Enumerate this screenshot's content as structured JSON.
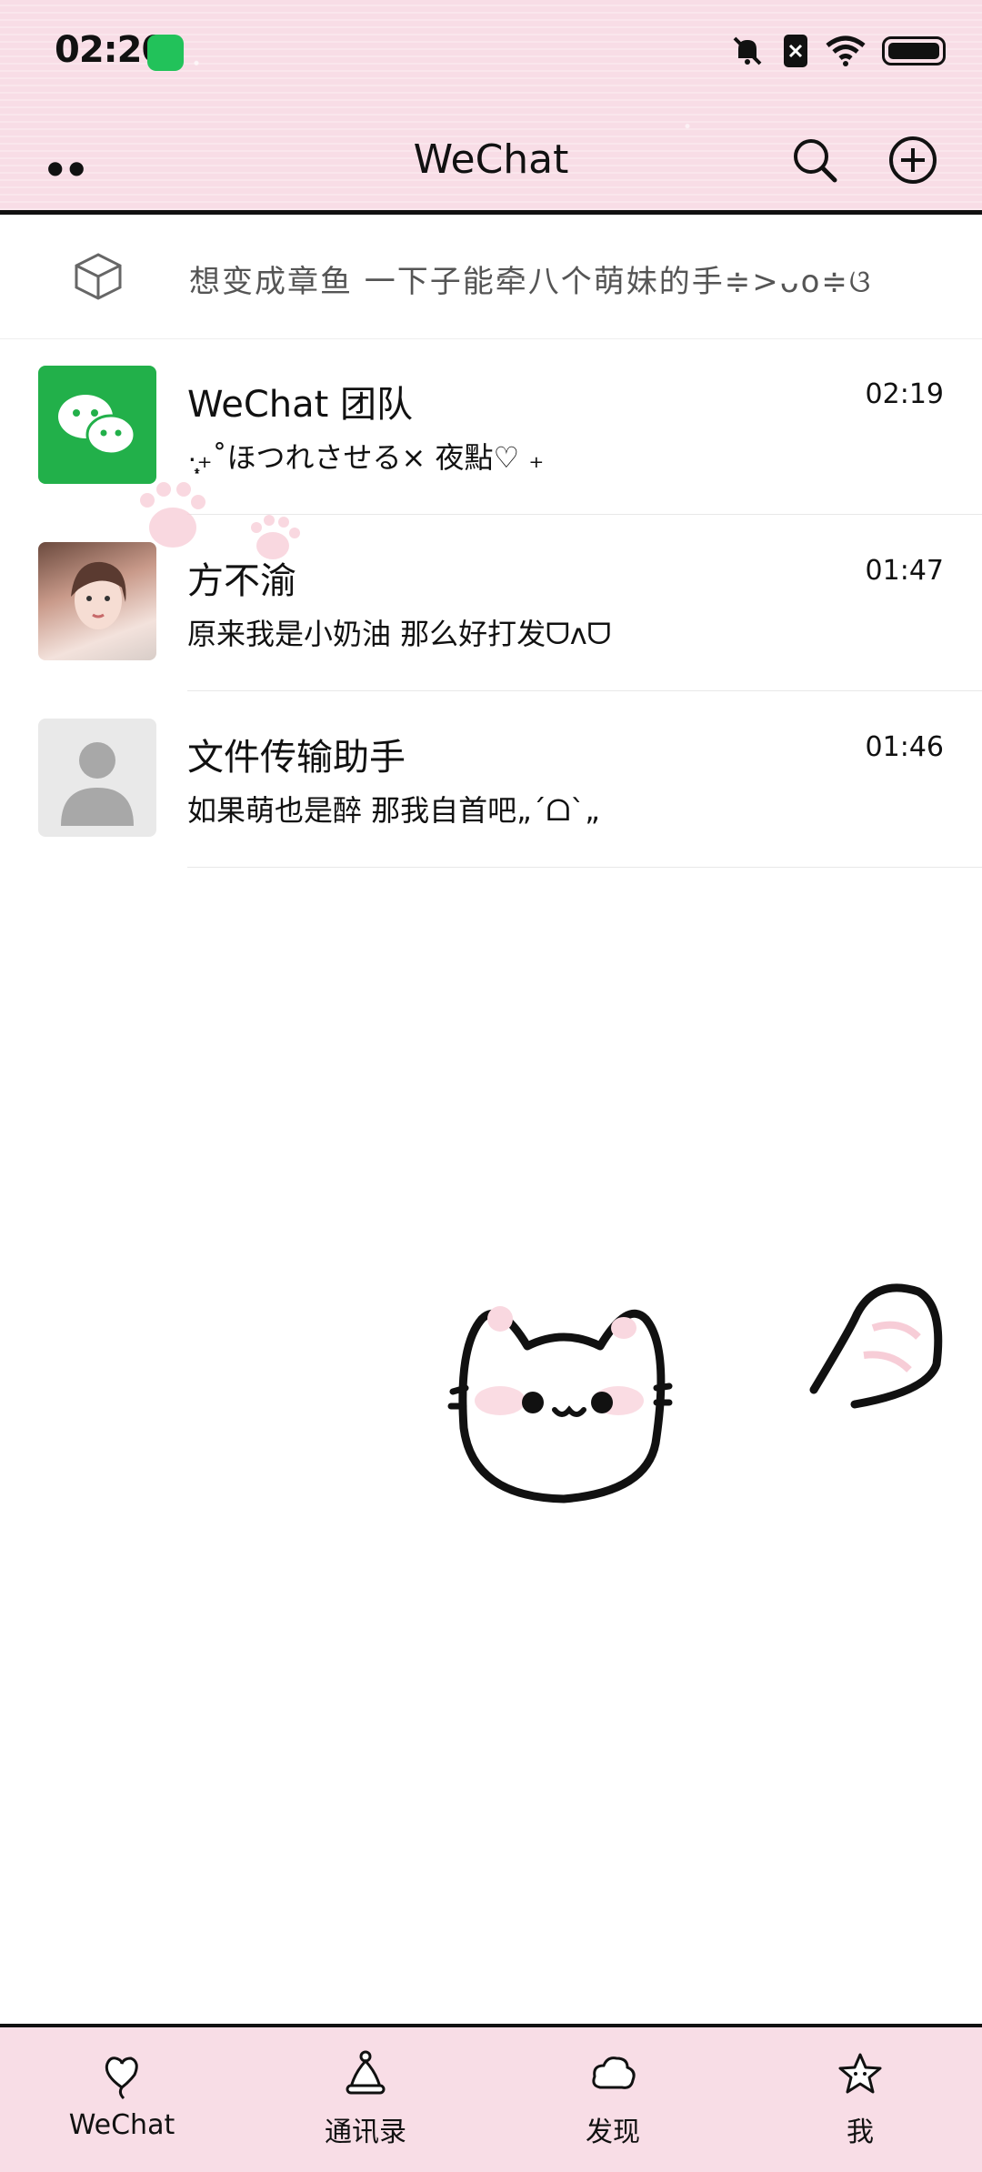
{
  "status_bar": {
    "time": "02:20"
  },
  "header": {
    "title": "WeChat"
  },
  "pinned": {
    "text": "想变成章鱼 一下子能牵八个萌妹的手≑>ᴗo≑ଓ"
  },
  "chats": [
    {
      "name": "WeChat 团队",
      "preview": "·̩͙₊˚ほつれさせる× 夜點♡ ₊",
      "time": "02:19"
    },
    {
      "name": "方不渝",
      "preview": "原来我是小奶油 那么好打发ᗜᴧᗜ",
      "time": "01:47"
    },
    {
      "name": "文件传输助手",
      "preview": "如果萌也是醉 那我自首吧„ˊᗝˋ„",
      "time": "01:46"
    }
  ],
  "tabs": [
    {
      "label": "WeChat",
      "icon": "heart-balloon-icon"
    },
    {
      "label": "通讯录",
      "icon": "hat-icon"
    },
    {
      "label": "发现",
      "icon": "cloud-icon"
    },
    {
      "label": "我",
      "icon": "star-icon"
    }
  ],
  "colors": {
    "header_bg": "#f8dde6",
    "accent_green": "#22c25a"
  }
}
